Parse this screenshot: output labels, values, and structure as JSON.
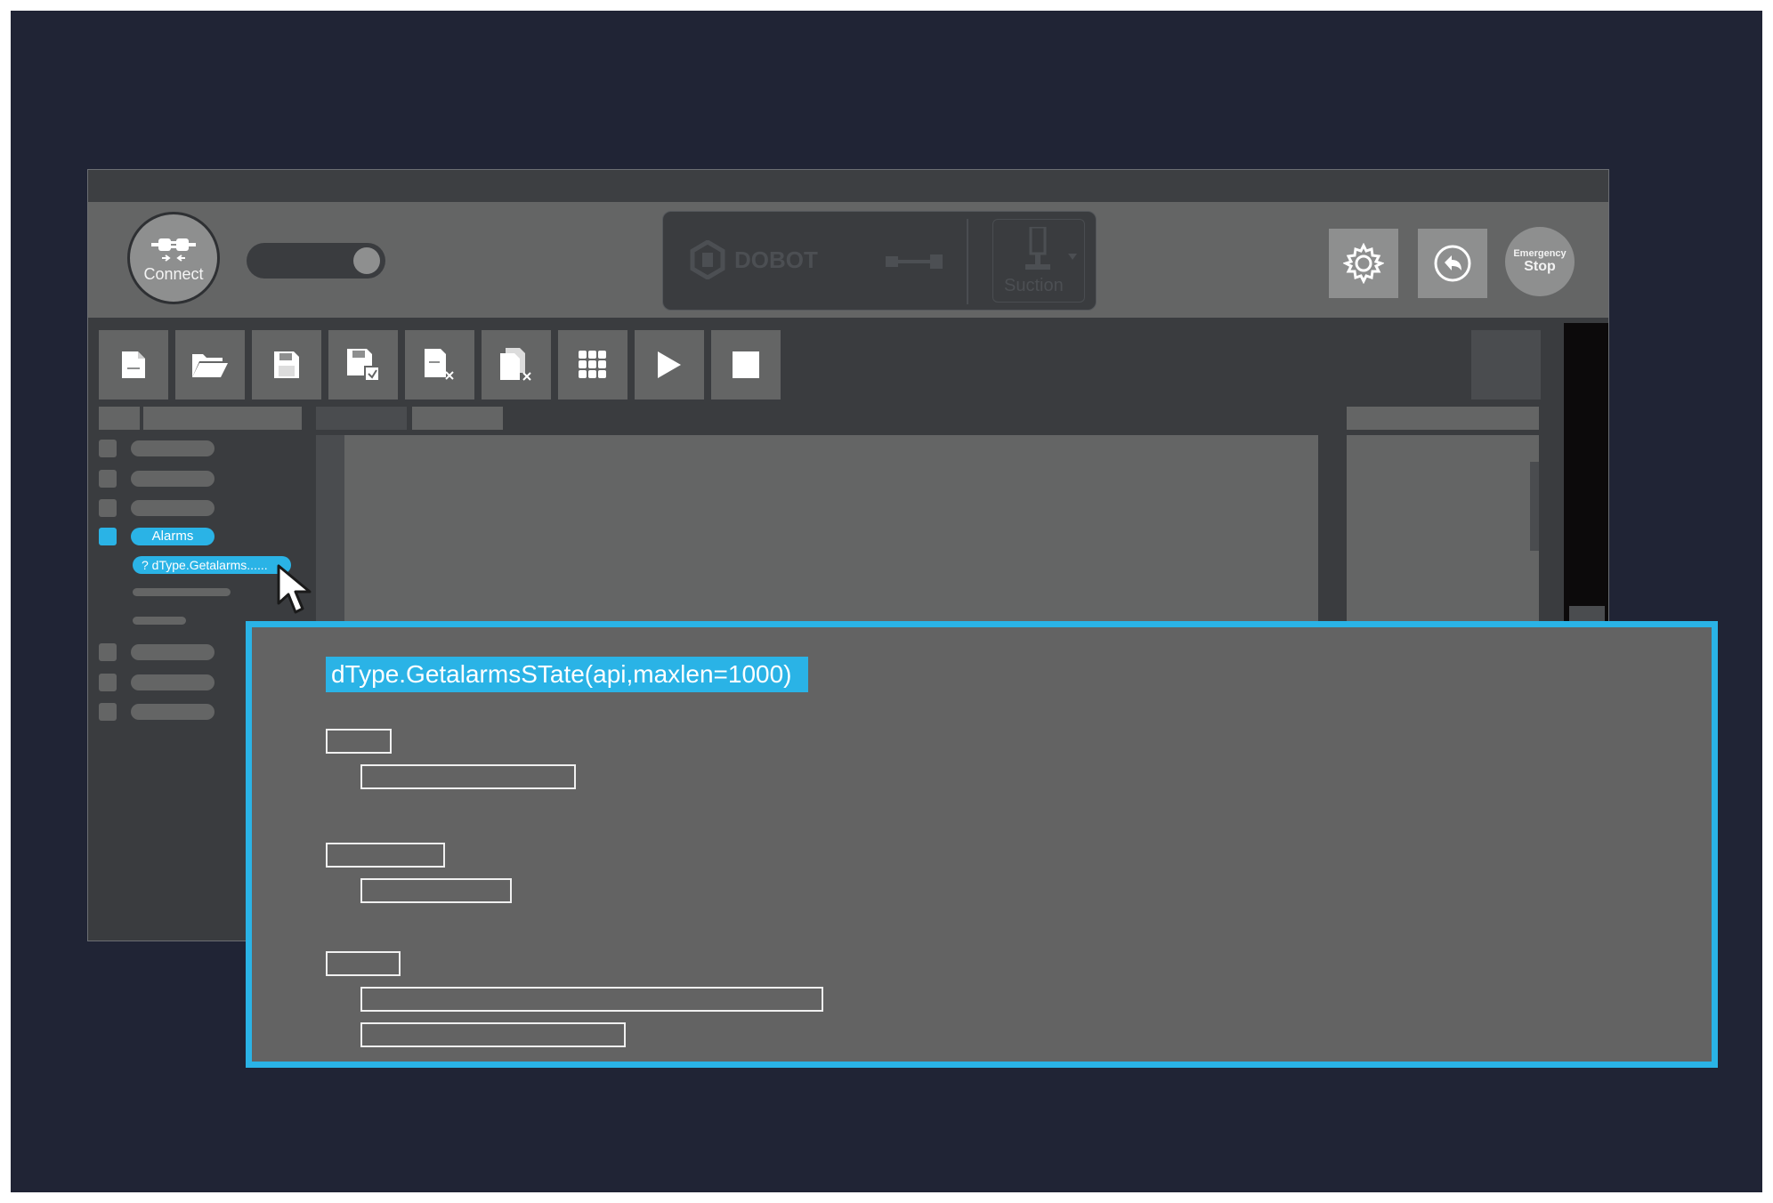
{
  "app": {
    "header": {
      "connect_label": "Connect",
      "device_brand": "DOBOT",
      "tool_name": "Suction",
      "emergency_line1": "Emergency",
      "emergency_line2": "Stop"
    },
    "toolbar": {
      "buttons": [
        "new-file-icon",
        "open-folder-icon",
        "save-icon",
        "save-as-icon",
        "close-file-icon",
        "close-all-icon",
        "grid-icon",
        "play-icon",
        "stop-icon"
      ]
    },
    "sidebar": {
      "active_item": "Alarms",
      "active_subitem": "? dType.Getalarms......"
    }
  },
  "popup": {
    "signature": "dType.GetalarmsSTate(api,maxlen=1000)"
  },
  "colors": {
    "accent": "#2ab3e6",
    "background": "#202435",
    "panel": "#646565"
  }
}
